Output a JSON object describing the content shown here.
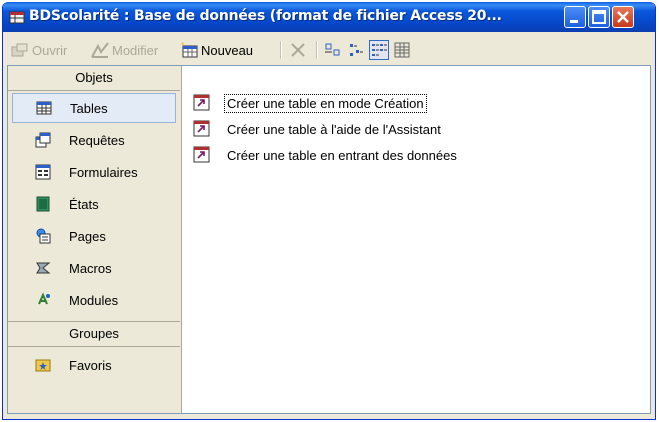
{
  "window": {
    "title": "BDScolarité : Base de données (format de fichier Access 20...",
    "colors": {
      "titlebar": "#0a58db",
      "close": "#c7381a",
      "panel": "#ece9d8"
    }
  },
  "toolbar": {
    "open_label": "Ouvrir",
    "modify_label": "Modifier",
    "new_label": "Nouveau",
    "icons": [
      "open-icon",
      "design-icon",
      "new-table-icon",
      "delete-icon",
      "large-icons-view-icon",
      "small-icons-view-icon",
      "list-view-icon",
      "details-view-icon"
    ]
  },
  "sidebar": {
    "objects_header": "Objets",
    "items": [
      {
        "label": "Tables",
        "icon": "table-icon",
        "selected": true
      },
      {
        "label": "Requêtes",
        "icon": "query-icon",
        "selected": false
      },
      {
        "label": "Formulaires",
        "icon": "form-icon",
        "selected": false
      },
      {
        "label": "États",
        "icon": "report-icon",
        "selected": false
      },
      {
        "label": "Pages",
        "icon": "page-icon",
        "selected": false
      },
      {
        "label": "Macros",
        "icon": "macro-icon",
        "selected": false
      },
      {
        "label": "Modules",
        "icon": "module-icon",
        "selected": false
      }
    ],
    "groups_header": "Groupes",
    "favorites_label": "Favoris"
  },
  "list": {
    "items": [
      {
        "label": "Créer une table en mode Création",
        "icon": "shortcut-icon"
      },
      {
        "label": "Créer une table à l'aide de l'Assistant",
        "icon": "shortcut-icon"
      },
      {
        "label": "Créer une table en entrant des données",
        "icon": "shortcut-icon"
      }
    ]
  }
}
